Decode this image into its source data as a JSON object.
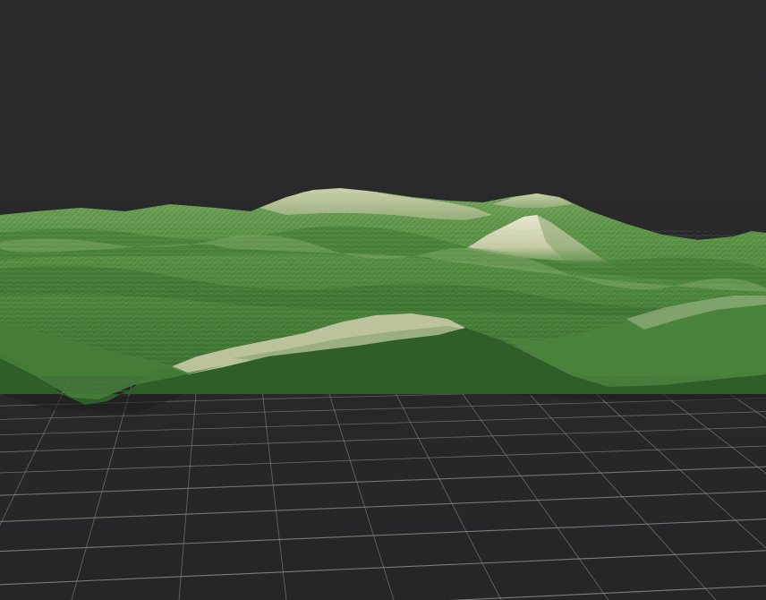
{
  "viewport": {
    "background_color": "#2b2b2c",
    "ground_grid": {
      "visible": true,
      "line_color": "#8a8a8c"
    },
    "terrain_model": {
      "type": "3d-relief-mesh",
      "lowland_color": "#3f7a34",
      "midland_color": "#5c9447",
      "highland_color": "#cfd0b0",
      "shadow_color": "#1f3f1b"
    }
  }
}
